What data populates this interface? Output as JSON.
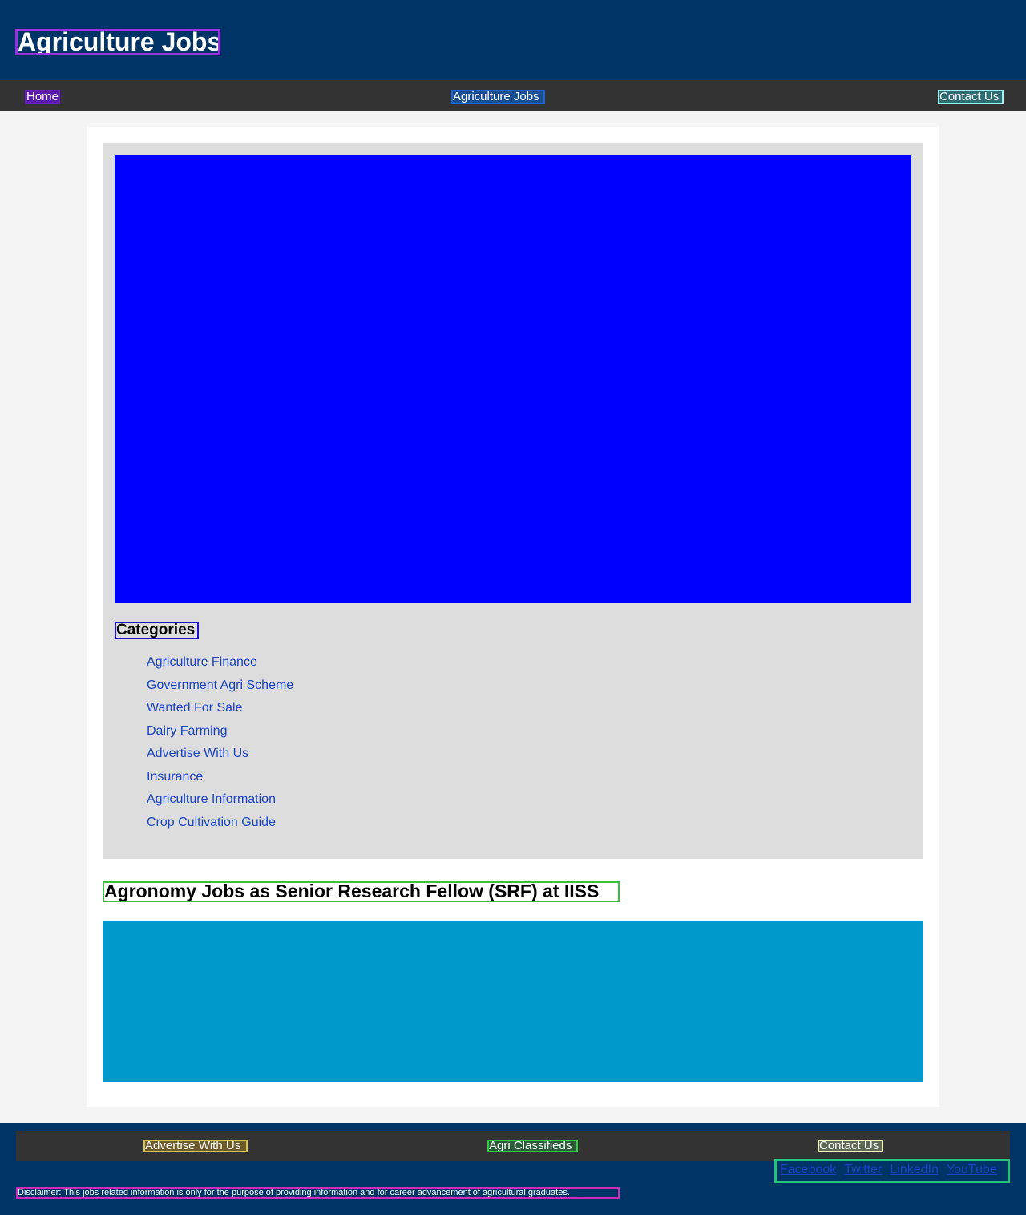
{
  "header": {
    "title": "Agriculture Jobs"
  },
  "nav": {
    "home": "Home",
    "jobs": "Agriculture Jobs",
    "contact": "Contact Us"
  },
  "sidebar": {
    "categories_title": "Categories",
    "categories": [
      "Agriculture Finance",
      "Government Agri Scheme",
      "Wanted For Sale",
      "Dairy Farming",
      "Advertise With Us",
      "Insurance",
      "Agriculture Information",
      "Crop Cultivation Guide"
    ]
  },
  "post": {
    "title": "Agronomy Jobs as Senior Research Fellow (SRF) at IISS"
  },
  "footer": {
    "links": {
      "advertise": "Advertise With Us",
      "classifieds": "Agri Classifieds",
      "contact": "Contact Us"
    },
    "social": [
      "Facebook",
      "Twitter",
      "LinkedIn",
      "YouTube"
    ],
    "disclaimer": "Disclaimer: This jobs related information is only for the purpose of providing information and for career advancement of agricultural graduates."
  },
  "colors": {
    "header_bg": "#003366",
    "nav_bg": "#333333",
    "banner": "#0000ff",
    "post_block": "#0099cc",
    "sidebar_bg": "#dddddd",
    "link": "#1a44c2"
  }
}
